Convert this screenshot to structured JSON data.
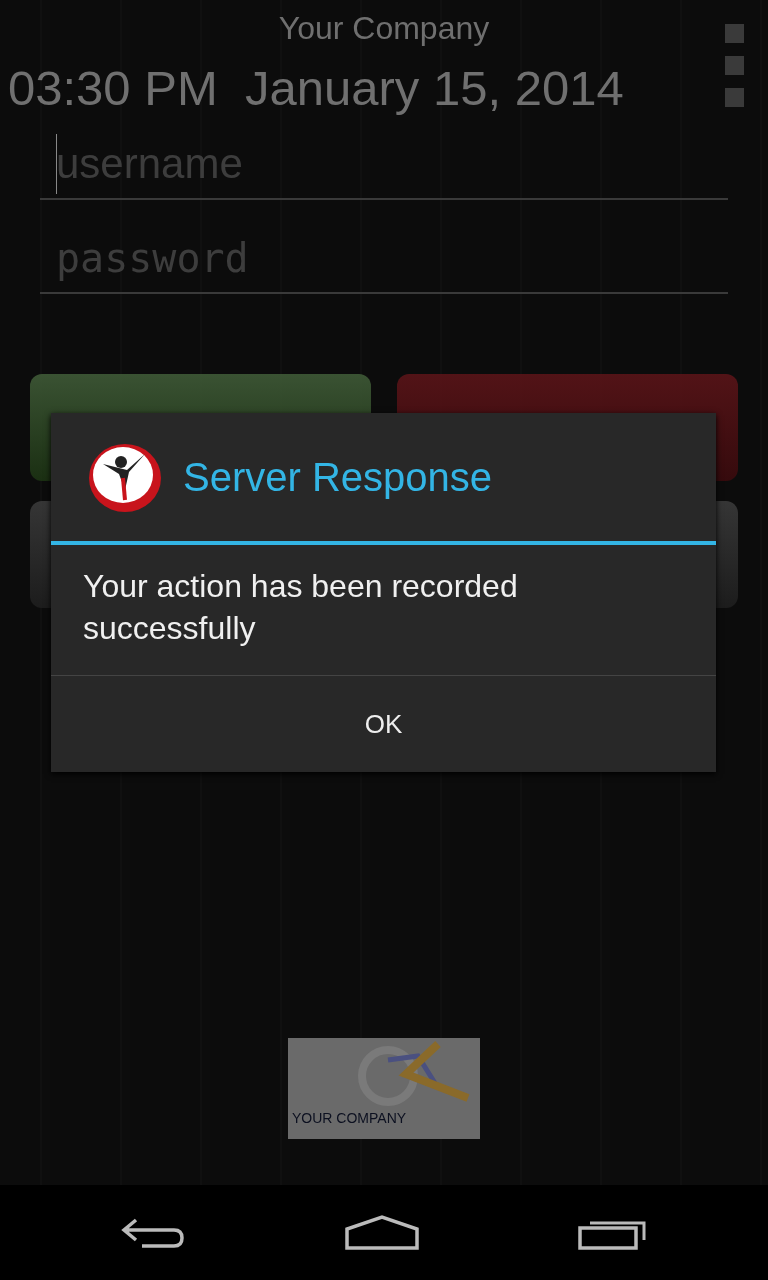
{
  "header": {
    "title": "Your Company",
    "datetime": "03:30 PM  January 15, 2014"
  },
  "form": {
    "username": {
      "placeholder": "username"
    },
    "password": {
      "placeholder": "password"
    }
  },
  "action_buttons": [
    {
      "kind": "green"
    },
    {
      "kind": "red"
    },
    {
      "kind": "grey"
    },
    {
      "kind": "grey"
    }
  ],
  "dialog": {
    "title": "Server Response",
    "message": "Your action has been recorded successfully",
    "buttons": [
      "OK"
    ]
  },
  "logo": {
    "text": "YOUR COMPANY"
  }
}
